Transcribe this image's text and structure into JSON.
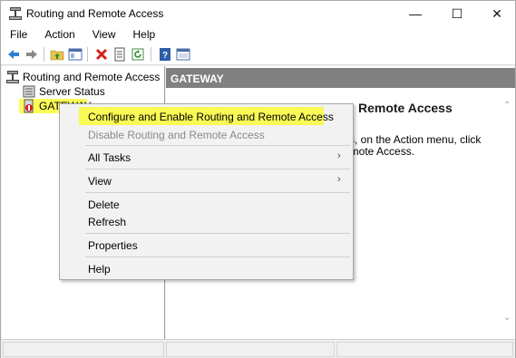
{
  "window": {
    "title": "Routing and Remote Access",
    "controls": {
      "minimize": "—",
      "maximize": "☐",
      "close": "✕"
    }
  },
  "menubar": [
    "File",
    "Action",
    "View",
    "Help"
  ],
  "toolbar_icons": [
    "back-arrow-icon",
    "forward-arrow-icon",
    "up-folder-icon",
    "show-hide-tree-icon",
    "delete-icon",
    "properties-icon",
    "refresh-icon",
    "help-icon",
    "console-tree-icon"
  ],
  "tree": {
    "root": "Routing and Remote Access",
    "items": [
      {
        "label": "Server Status"
      },
      {
        "label": "GATEWAY"
      }
    ]
  },
  "right_pane": {
    "header": "GATEWAY",
    "heading_visible": "Remote Access",
    "body_line1": "ss, on the Action menu, click",
    "body_line2": "emote Access."
  },
  "context_menu": {
    "items": [
      {
        "label": "Configure and Enable Routing and Remote Access",
        "disabled": false,
        "highlighted": true
      },
      {
        "label": "Disable Routing and Remote Access",
        "disabled": true
      },
      {
        "label": "All Tasks",
        "submenu": true
      },
      {
        "label": "View",
        "submenu": true
      },
      {
        "label": "Delete"
      },
      {
        "label": "Refresh"
      },
      {
        "label": "Properties"
      },
      {
        "label": "Help"
      }
    ],
    "submenu_arrow": "›"
  },
  "colors": {
    "highlight": "#fbfb3a",
    "header_bg": "#808080",
    "disabled_text": "#8a8a8a"
  }
}
